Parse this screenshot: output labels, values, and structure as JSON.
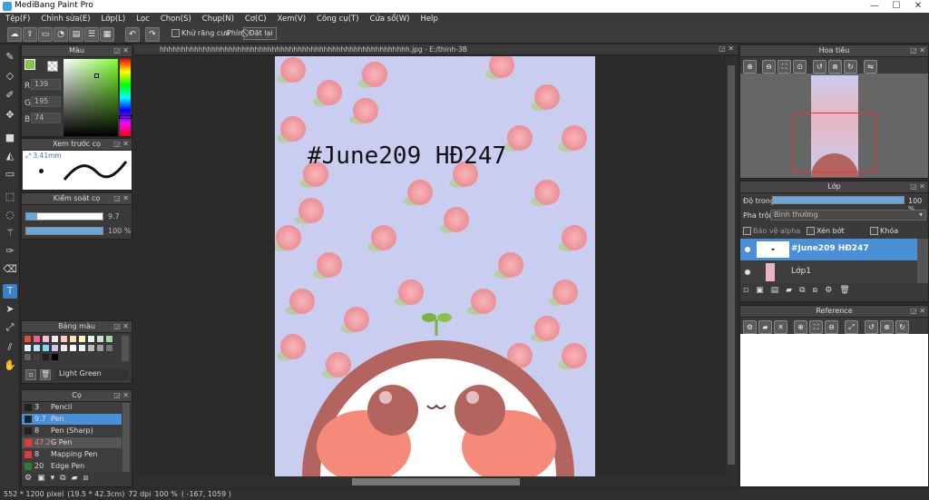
{
  "app": {
    "title": "MediBang Paint Pro",
    "minimize": "—",
    "maximize": "☐",
    "close": "✕"
  },
  "menu": [
    "Tệp(F)",
    "Chỉnh sửa(E)",
    "Lớp(L)",
    "Lọc",
    "Chọn(S)",
    "Chụp(N)",
    "Cơ(C)",
    "Xem(V)",
    "Công cụ(T)",
    "Cửa sổ(W)",
    "Help"
  ],
  "toolbar": {
    "antialias_label": "Khử răng cưa",
    "key_label": "Phím",
    "reset_label": "Đặt lại"
  },
  "document_tab": "hhhhhhhhhhhhhhhhhhhhhhhhhhhhhhhhhhhhhhhhhhhhhhhhhhhhhhhhhh.jpg - E:/thinh-3B",
  "color_panel": {
    "title": "Màu",
    "r_label": "R",
    "g_label": "G",
    "b_label": "B",
    "r": "139",
    "g": "195",
    "b": "74",
    "fg_color": "#8bc34a"
  },
  "brush_preview": {
    "title": "Xem trước cọ",
    "size": "3.41mm"
  },
  "brush_control": {
    "title": "Kiểm soát cọ",
    "size_value": "9.7",
    "size_fraction": 0.14,
    "opacity_value": "100 %",
    "opacity_fraction": 1.0
  },
  "palette": {
    "title": "Bảng màu",
    "selected_name": "Light Green",
    "swatches": [
      "#e74c3c",
      "#f06292",
      "#f8bbd0",
      "#fce4ec",
      "#ffccbc",
      "#ffe0b2",
      "#fff9c4",
      "#e8f5e9",
      "#c8e6c9",
      "#a5d6a7",
      "#e1f5fe",
      "#b3e5fc",
      "#81d4fa",
      "#d1c4e9",
      "#f3e5f5",
      "#ffffff",
      "#eeeeee",
      "#bdbdbd",
      "#9e9e9e",
      "#757575",
      "#616161",
      "#424242",
      "#212121",
      "#000000"
    ]
  },
  "brush_list": {
    "title": "Cọ",
    "items": [
      {
        "size": "3",
        "name": "Pencil",
        "color": "#222222"
      },
      {
        "size": "9.7",
        "name": "Pen",
        "color": "#222222"
      },
      {
        "size": "8",
        "name": "Pen (Sharp)",
        "color": "#222222"
      },
      {
        "size": "47.2",
        "name": "G Pen",
        "color": "#e53935"
      },
      {
        "size": "8",
        "name": "Mapping Pen",
        "color": "#e53935"
      },
      {
        "size": "20",
        "name": "Edge Pen",
        "color": "#2e7d32"
      }
    ]
  },
  "canvas": {
    "title_text": "#June209  HĐ247"
  },
  "navigator": {
    "title": "Hoa tiêu"
  },
  "layer_panel": {
    "title": "Lớp",
    "opacity_label": "Độ trong",
    "opacity_value": "100 %",
    "opacity_fraction": 1.0,
    "blend_label": "Pha trộn",
    "blend_value": "Bình thường",
    "protect_alpha": "Bảo vệ alpha",
    "clipping": "Xén bớt",
    "lock": "Khóa",
    "layers": [
      {
        "name": "#June209 HĐ247",
        "selected": true
      },
      {
        "name": "Lớp1",
        "selected": false
      }
    ]
  },
  "reference": {
    "title": "Reference"
  },
  "status": {
    "pixels": "552 * 1200 pixel",
    "cm": "(19.5 * 42.3cm)",
    "dpi": "72 dpi",
    "zoom": "100 %",
    "coords": "( -167, 1059 )"
  }
}
